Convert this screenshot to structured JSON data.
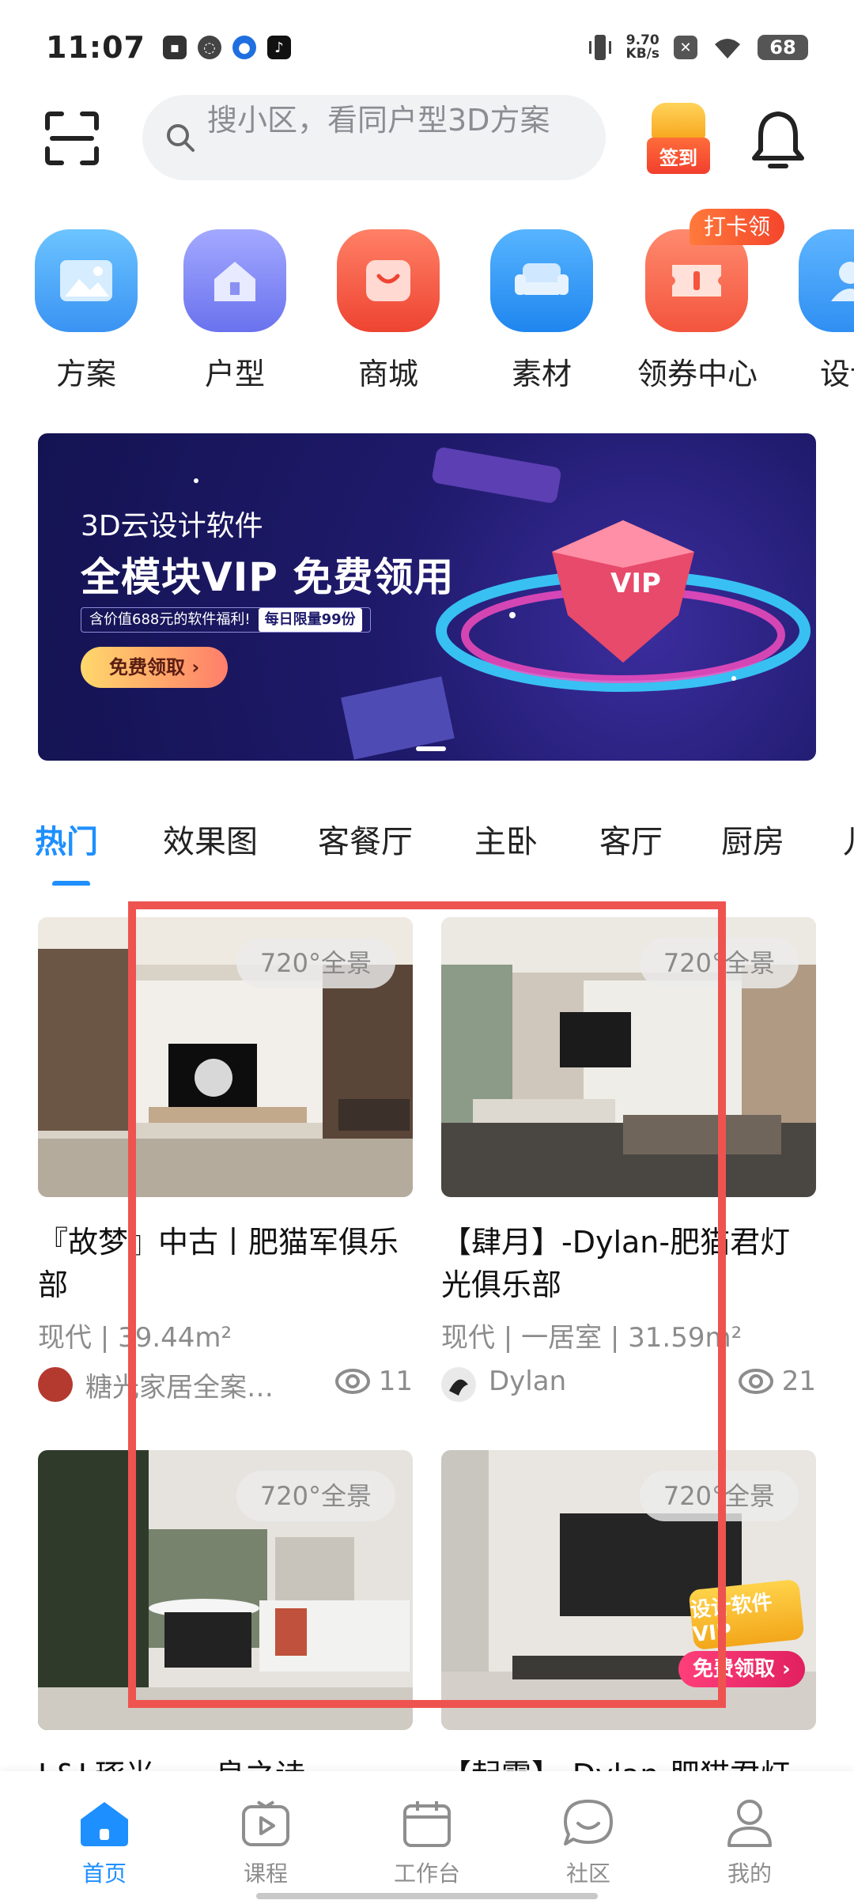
{
  "status_bar": {
    "time": "11:07",
    "net_speed_value": "9.70",
    "net_speed_unit": "KB/s",
    "battery": "68"
  },
  "search": {
    "placeholder": "搜小区，看同户型3D方案",
    "checkin_label": "签到"
  },
  "quick_menu": [
    {
      "label": "方案",
      "icon": "image-icon",
      "color": "#4aa8f8"
    },
    {
      "label": "户型",
      "icon": "house-icon",
      "color": "#7b86f3"
    },
    {
      "label": "商城",
      "icon": "shopping-bag-icon",
      "color": "#f45b4b"
    },
    {
      "label": "素材",
      "icon": "sofa-icon",
      "color": "#2f97f5"
    },
    {
      "label": "领券中心",
      "icon": "coupon-icon",
      "color": "#f7654b"
    },
    {
      "label": "设计",
      "icon": "user-icon",
      "color": "#3c9cf7"
    }
  ],
  "quick_badge": "打卡领",
  "banner": {
    "subtitle": "3D云设计软件",
    "title": "全模块VIP 免费领用",
    "note": "含价值688元的软件福利!",
    "limit": "每日限量99份",
    "cta": "免费领取 ›",
    "gem_text": "VIP"
  },
  "tabs": [
    "热门",
    "效果图",
    "客餐厅",
    "主卧",
    "客厅",
    "厨房",
    "儿"
  ],
  "cards": [
    {
      "badge": "720°全景",
      "title": "『故梦』中古丨肥猫军俱乐部",
      "meta": "现代 | 39.44m²",
      "author": "糖光家居全案…",
      "views": "11"
    },
    {
      "badge": "720°全景",
      "title": "【肆月】-Dylan-肥猫君灯光俱乐部",
      "meta": "现代 | 一居室 | 31.59m²",
      "author": "Dylan",
      "views": "21"
    },
    {
      "badge": "720°全景",
      "title": "L&L琢光——良之诗"
    },
    {
      "badge": "720°全景",
      "title": "【起零】-Dylan-肥猫君灯",
      "promo_top": "设计软件VIP",
      "promo_btn": "免费领取 ›"
    }
  ],
  "bottom_nav": [
    {
      "label": "首页",
      "icon": "home-icon"
    },
    {
      "label": "课程",
      "icon": "play-icon"
    },
    {
      "label": "工作台",
      "icon": "calendar-icon"
    },
    {
      "label": "社区",
      "icon": "chat-icon"
    },
    {
      "label": "我的",
      "icon": "profile-icon"
    }
  ],
  "colors": {
    "accent": "#1e8fff",
    "annotation": "#ee5350"
  }
}
